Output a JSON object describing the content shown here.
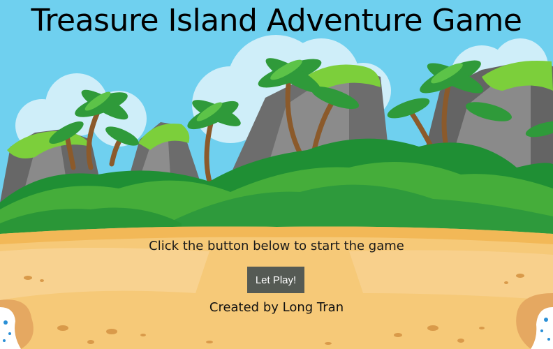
{
  "game": {
    "title": "Treasure Island Adventure Game",
    "instructions": "Click the button below to start the game",
    "play_button_label": "Let Play!",
    "credit": "Created by Long Tran"
  },
  "scene": {
    "type": "tropical island background",
    "colors": {
      "sky": "#6fd0ef",
      "cloud": "#cfeef9",
      "rock": "#6e6e6e",
      "grass": "#2e9a3c",
      "sand": "#f6c978",
      "water": "#2a8fd6",
      "button": "#555a54"
    }
  }
}
